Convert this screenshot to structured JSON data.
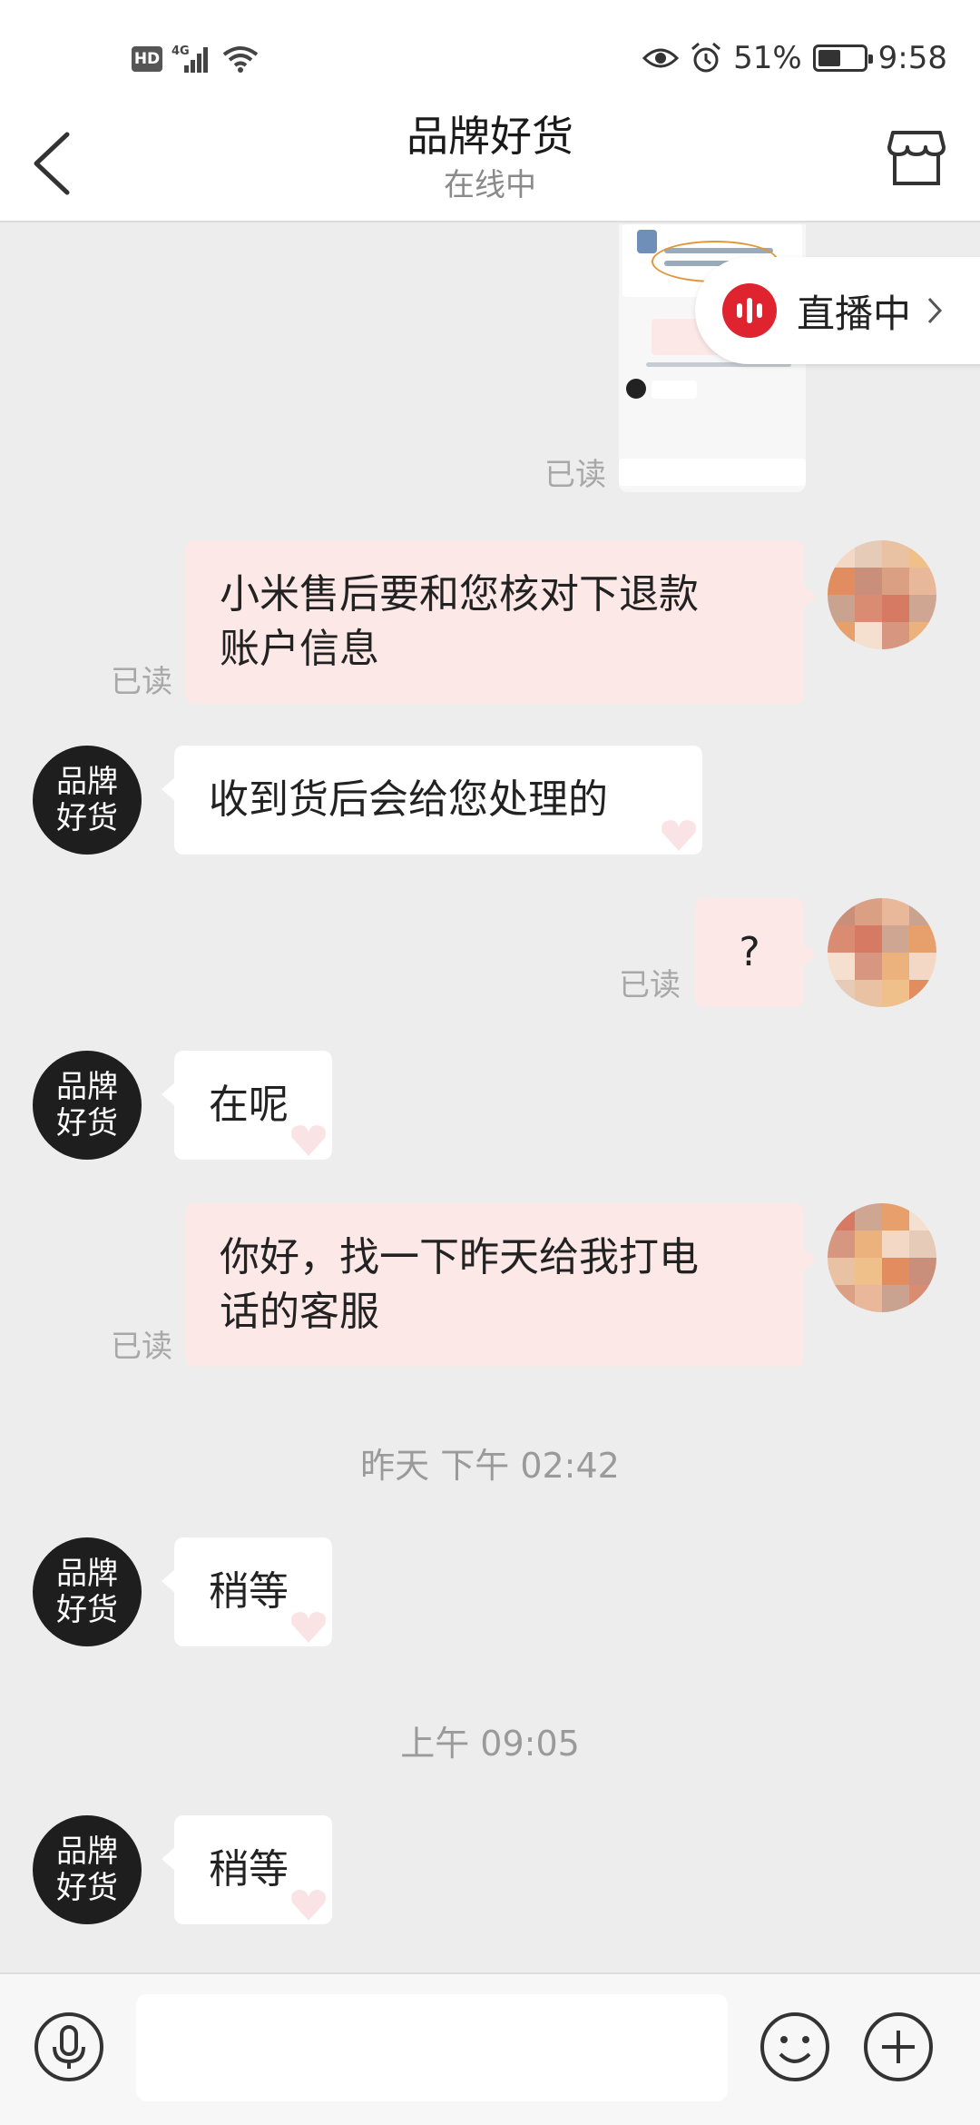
{
  "status_bar": {
    "hd": "HD",
    "network": "4G",
    "battery": "51%",
    "battery_level": 0.51,
    "time": "9:58"
  },
  "header": {
    "title": "品牌好货",
    "subtitle": "在线中"
  },
  "live": {
    "label": "直播中"
  },
  "shop": {
    "avatar_line1": "品牌",
    "avatar_line2": "好货"
  },
  "messages": [
    {
      "from": "me",
      "read_label": "已读",
      "type": "image"
    },
    {
      "from": "me",
      "read_label": "已读",
      "lines": [
        "小米售后要和您核对下退款",
        "账户信息"
      ]
    },
    {
      "from": "shop",
      "text": "收到货后会给您处理的"
    },
    {
      "from": "me",
      "read_label": "已读",
      "text": "?"
    },
    {
      "from": "shop",
      "text": "在呢"
    },
    {
      "from": "me",
      "read_label": "已读",
      "lines": [
        "你好，找一下昨天给我打电",
        "话的客服"
      ]
    },
    {
      "type": "time",
      "text": "昨天 下午 02:42"
    },
    {
      "from": "shop",
      "text": "稍等"
    },
    {
      "type": "time",
      "text": "上午 09:05"
    },
    {
      "from": "shop",
      "text": "稍等"
    }
  ],
  "input": {
    "placeholder": ""
  },
  "colors": {
    "chat_bg": "#ededed",
    "my_bubble": "#fde8e8",
    "shop_bubble": "#ffffff",
    "live_accent": "#e0242f"
  }
}
